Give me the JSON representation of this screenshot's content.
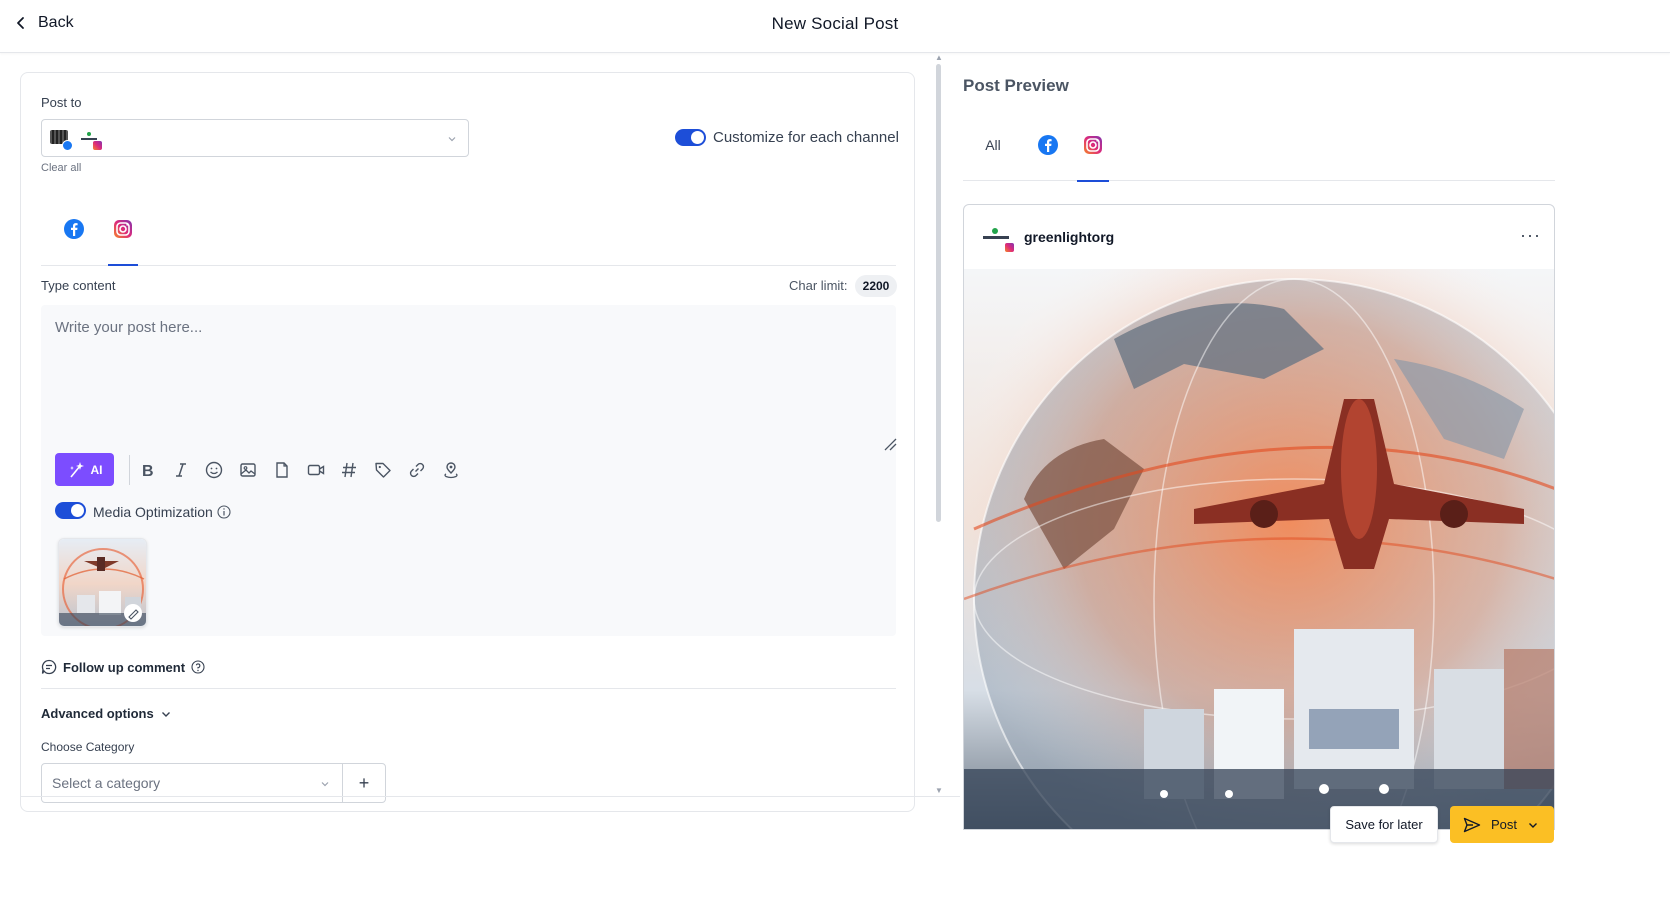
{
  "header": {
    "back_label": "Back",
    "title": "New Social Post"
  },
  "composer": {
    "post_to_label": "Post to",
    "clear_all_label": "Clear all",
    "customize_label": "Customize for each channel",
    "customize_enabled": true,
    "channel_tabs": [
      {
        "icon": "facebook-icon",
        "active": false
      },
      {
        "icon": "instagram-icon",
        "active": true
      }
    ],
    "type_content_label": "Type content",
    "char_limit_label": "Char limit:",
    "char_limit_value": "2200",
    "editor_placeholder": "Write your post here...",
    "ai_button_label": "AI",
    "toolbar_icons": [
      "bold-icon",
      "italic-icon",
      "emoji-icon",
      "image-icon",
      "document-icon",
      "video-icon",
      "hashtag-icon",
      "tag-icon",
      "link-icon",
      "location-icon"
    ],
    "media_optimization_label": "Media Optimization",
    "media_optimization_enabled": true,
    "follow_up_label": "Follow up comment",
    "advanced_options_label": "Advanced options",
    "choose_category_label": "Choose Category",
    "category_placeholder": "Select a category",
    "add_category_label": "+"
  },
  "preview": {
    "title": "Post Preview",
    "tabs": [
      {
        "label": "All",
        "active": false
      },
      {
        "icon": "facebook-icon",
        "active": false
      },
      {
        "icon": "instagram-icon",
        "active": true
      }
    ],
    "account_name": "greenlightorg",
    "more_label": "···"
  },
  "actions": {
    "save_later_label": "Save for later",
    "post_label": "Post"
  },
  "colors": {
    "accent": "#1d4ed8",
    "ai_purple": "#7c4dff",
    "post_yellow": "#fbbf24",
    "facebook_blue": "#1877f2"
  }
}
